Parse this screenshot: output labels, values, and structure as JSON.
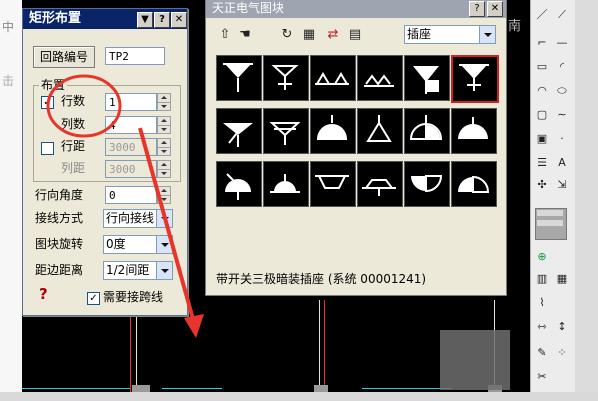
{
  "bg_text": {
    "left_top": "中",
    "left_mid": "击",
    "canvas_right": "南"
  },
  "dialog": {
    "title": "矩形布置",
    "title_buttons": [
      "▼",
      "?",
      "✕"
    ],
    "loop_button": "回路编号",
    "loop_value": "TP2",
    "group_label": "布置",
    "rows_label": "行数",
    "rows_checked": true,
    "rows_value": "1",
    "cols_label": "列数",
    "cols_value": "4",
    "rowdist_label": "行距",
    "rowdist_checked": false,
    "rowdist_value": "3000",
    "coldist_label": "列距",
    "coldist_value": "3000",
    "angle_label": "行向角度",
    "angle_value": "0",
    "wiring_label": "接线方式",
    "wiring_value": "行向接线",
    "rotate_label": "图块旋转",
    "rotate_value": "0度",
    "edge_label": "距边距离",
    "edge_value": "1/2间距",
    "help": "?",
    "jump_label": "需要接跨线",
    "jump_checked": true
  },
  "library": {
    "title": "天正电气图块",
    "category": "插座",
    "status": "带开关三极暗装插座  (系统 00001241)",
    "selected_index": 5,
    "icons": [
      "socket-icon-1",
      "socket-icon-2",
      "socket-icon-3",
      "socket-icon-4",
      "socket-icon-5",
      "socket-icon-6",
      "socket-icon-7",
      "socket-icon-8",
      "socket-icon-9",
      "socket-icon-10",
      "socket-icon-11",
      "socket-icon-12",
      "socket-icon-13",
      "socket-icon-14",
      "socket-icon-15",
      "socket-icon-16",
      "socket-icon-17",
      "socket-icon-18"
    ]
  },
  "colors": {
    "title_active": "#0a246a",
    "annotation": "#e8352b",
    "cad_red": "#e03030",
    "cad_cyan": "#2ec9d6"
  }
}
